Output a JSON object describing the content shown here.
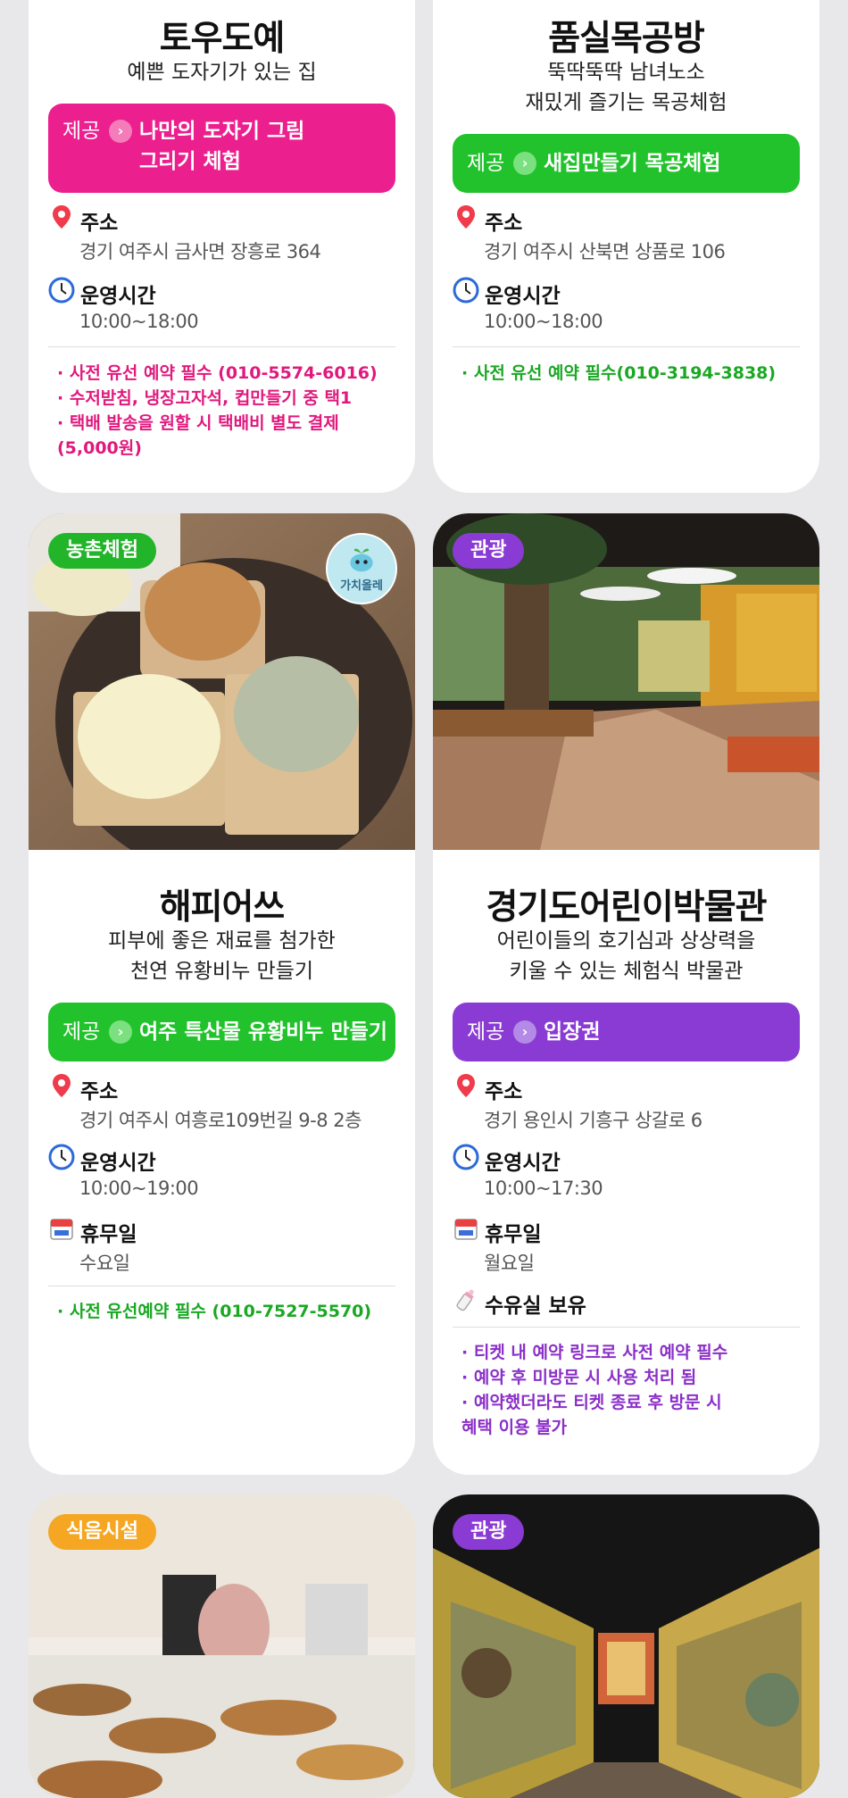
{
  "labels": {
    "provide": "제공",
    "address": "주소",
    "hours": "운영시간",
    "closed": "휴무일"
  },
  "cards": [
    {
      "title": "토우도예",
      "description": "예쁜 도자기가 있는 집",
      "offer": "나만의 도자기 그림\n그리기 체험",
      "offer_color": "#ec1f8e",
      "address": "경기 여주시 금사면 장흥로 364",
      "hours": "10:00~18:00",
      "notes_color": "#e0197d",
      "notes": [
        "· 사전 유선 예약 필수 (010-5574-6016)",
        "· 수저받침, 냉장고자석, 컵만들기 중 택1",
        "· 택배 발송을 원할 시 택배비 별도 결제\n  (5,000원)"
      ]
    },
    {
      "title": "품실목공방",
      "description_1": "뚝딱뚝딱 남녀노소",
      "description_2": "재밌게 즐기는 목공체험",
      "offer": "새집만들기 목공체험",
      "offer_color": "#22c22c",
      "address": "경기 여주시 산북면 상품로 106",
      "hours": "10:00~18:00",
      "notes_color": "#1aa823",
      "notes": [
        "· 사전 유선 예약 필수(010-3194-3838)"
      ]
    },
    {
      "badge": "농촌체험",
      "badge_color": "#22b52a",
      "logo_text": "가치올레",
      "title": "해피어쓰",
      "description_1": "피부에 좋은 재료를 첨가한",
      "description_2": "천연 유황비누 만들기",
      "offer": "여주 특산물 유황비누 만들기",
      "offer_color": "#22c22c",
      "address": "경기 여주시 여흥로109번길 9-8 2층",
      "hours": "10:00~19:00",
      "closed": "수요일",
      "notes_color": "#1aa823",
      "notes": [
        "· 사전 유선예약 필수 (010-7527-5570)"
      ]
    },
    {
      "badge": "관광",
      "badge_color": "#8a3bd4",
      "title": "경기도어린이박물관",
      "description_1": "어린이들의 호기심과 상상력을",
      "description_2": "키울 수 있는 체험식 박물관",
      "offer": "입장권",
      "offer_color": "#8a3bd4",
      "address": "경기 용인시 기흥구 상갈로 6",
      "hours": "10:00~17:30",
      "closed": "월요일",
      "nursing": "수유실 보유",
      "notes_color": "#8a2fc8",
      "notes": [
        "· 티켓 내 예약 링크로 사전 예약 필수",
        "· 예약 후 미방문 시 사용 처리 됨",
        "· 예약했더라도 티켓 종료 후 방문 시\n  혜택 이용 불가"
      ]
    },
    {
      "badge": "식음시설",
      "badge_color": "#f5a623"
    },
    {
      "badge": "관광",
      "badge_color": "#8a3bd4"
    }
  ]
}
